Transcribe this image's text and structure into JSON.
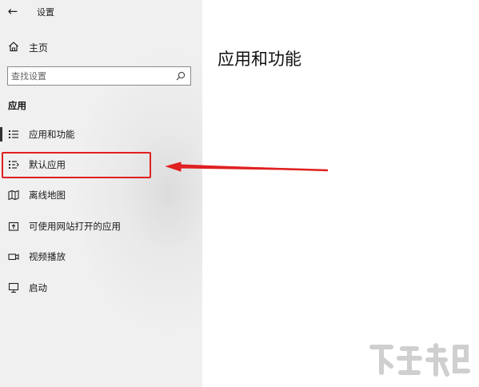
{
  "window": {
    "title": "设置",
    "back_icon": "back-arrow-icon"
  },
  "sidebar": {
    "home_label": "主页",
    "search_placeholder": "查找设置",
    "section_title": "应用",
    "items": [
      {
        "label": "应用和功能",
        "icon": "apps-features-icon",
        "selected": true
      },
      {
        "label": "默认应用",
        "icon": "default-apps-icon",
        "selected": false,
        "highlighted": true
      },
      {
        "label": "离线地图",
        "icon": "offline-maps-icon",
        "selected": false
      },
      {
        "label": "可使用网站打开的应用",
        "icon": "apps-for-websites-icon",
        "selected": false
      },
      {
        "label": "视频播放",
        "icon": "video-playback-icon",
        "selected": false
      },
      {
        "label": "启动",
        "icon": "startup-icon",
        "selected": false
      }
    ]
  },
  "main": {
    "title": "应用和功能"
  },
  "annotation": {
    "highlight_color": "#e02020",
    "arrow_color": "#e02020"
  },
  "colors": {
    "sidebar_bg": "#f0f0f0",
    "content_bg": "#ffffff",
    "text": "#1a1a1a"
  }
}
